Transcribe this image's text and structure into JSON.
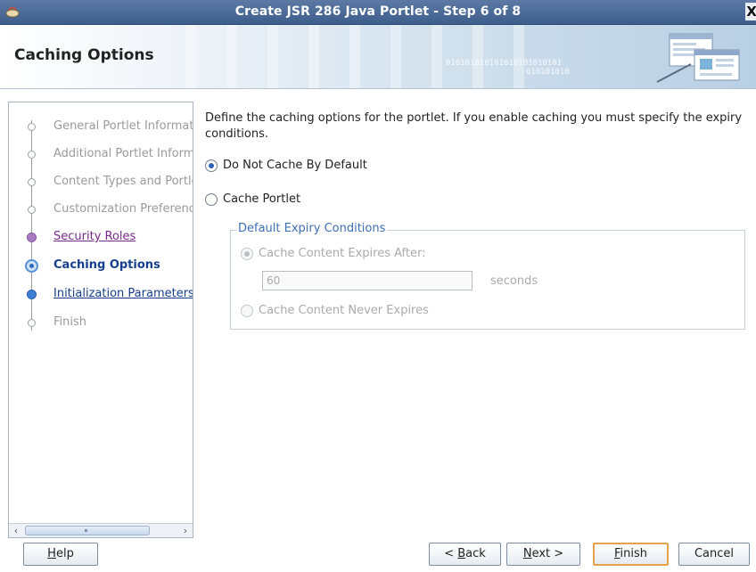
{
  "window": {
    "title": "Create JSR 286 Java Portlet - Step 6 of 8",
    "close_glyph": "X"
  },
  "header": {
    "page_title": "Caching Options",
    "binary_line1": "010101010101010101010101",
    "binary_line2": "010101010"
  },
  "nav": {
    "items": [
      {
        "label": "General Portlet Information",
        "state": "pending"
      },
      {
        "label": "Additional Portlet Information",
        "state": "pending"
      },
      {
        "label": "Content Types and Portlet Modes",
        "state": "pending"
      },
      {
        "label": "Customization Preferences",
        "state": "pending"
      },
      {
        "label": "Security Roles",
        "state": "visited"
      },
      {
        "label": "Caching Options",
        "state": "current"
      },
      {
        "label": "Initialization Parameters",
        "state": "link"
      },
      {
        "label": "Finish",
        "state": "pending"
      }
    ]
  },
  "main": {
    "description": "Define the caching options for the portlet. If you enable caching you must specify the expiry conditions.",
    "do_not_cache_label": "Do Not Cache By Default",
    "do_not_cache_selected": true,
    "cache_portlet_label": "Cache Portlet",
    "cache_portlet_selected": false,
    "expiry_group": {
      "legend": "Default Expiry Conditions",
      "expires_after_label": "Cache Content Expires After:",
      "expires_after_selected": true,
      "expires_value": "60",
      "unit": "seconds",
      "never_expires_label": "Cache Content Never Expires",
      "never_expires_selected": false
    }
  },
  "footer": {
    "help": {
      "pre": "",
      "mnemonic": "H",
      "post": "elp"
    },
    "back": {
      "pre": "< ",
      "mnemonic": "B",
      "post": "ack"
    },
    "next": {
      "pre": "",
      "mnemonic": "N",
      "post": "ext >"
    },
    "finish": {
      "pre": "",
      "mnemonic": "F",
      "post": "inish"
    },
    "cancel": "Cancel"
  },
  "colors": {
    "titlebar": "#4a6a98",
    "link": "#153f8e",
    "visited": "#7a2a8c",
    "legend": "#3d6fb6",
    "default_button_border": "#e6a24b"
  },
  "icons": {
    "app": "oracle-cup-icon",
    "header_art": "wizard-windows-art"
  }
}
